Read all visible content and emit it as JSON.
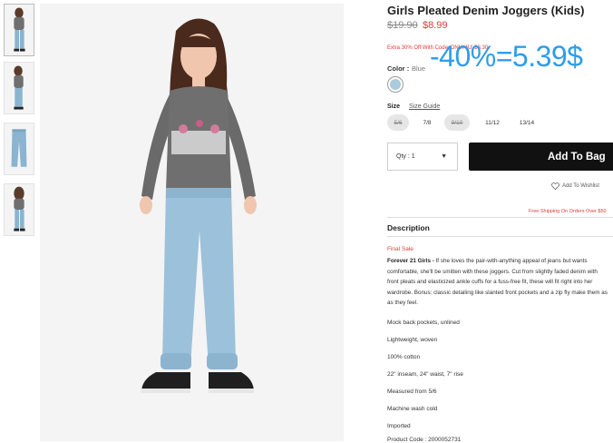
{
  "product": {
    "title": "Girls Pleated Denim Joggers (Kids)",
    "price_original": "$19.90",
    "price_sale": "$8.99",
    "promo_text": "Extra 30% Off With Code 'ONLY4U' $8.30",
    "overlay_note": "-40%=5.39$"
  },
  "color": {
    "label": "Color",
    "separator": ":",
    "value": "Blue",
    "swatch_hex": "#a9cbdb"
  },
  "size": {
    "label": "Size",
    "guide_link": "Size Guide",
    "options": [
      {
        "label": "5/6",
        "available": false
      },
      {
        "label": "7/8",
        "available": true
      },
      {
        "label": "9/10",
        "available": false
      },
      {
        "label": "11/12",
        "available": true
      },
      {
        "label": "13/14",
        "available": true
      }
    ]
  },
  "purchase": {
    "quantity": "Qty : 1",
    "quantity_arrow": "▼",
    "add_to_bag": "Add To Bag",
    "wishlist": "Add To Wishlist",
    "free_shipping": "Free Shipping On Orders Over $50"
  },
  "description": {
    "heading": "Description",
    "final_sale": "Final Sale",
    "brand": "Forever 21 Girls -",
    "body_lines": [
      " If she loves the pair-with-anything appeal of jeans but wants",
      "comfortable, she'll be smitten with these joggers. Cut from slightly faded denim with",
      "front pleats and elasticized ankle cuffs for a fuss-free fit, these will fit right into her",
      "wardrobe. Bonus: classic detailing like slanted front pockets and a zip fly make them as",
      "as they feel."
    ],
    "details": [
      "Mock back pockets, unlined",
      "Lightweight, woven",
      "100% cotton",
      "22\" inseam, 24\" waist, 7\" rise",
      "Measured from 5/6",
      "Machine wash cold",
      "Imported",
      "Product Code : 2000052731"
    ]
  }
}
